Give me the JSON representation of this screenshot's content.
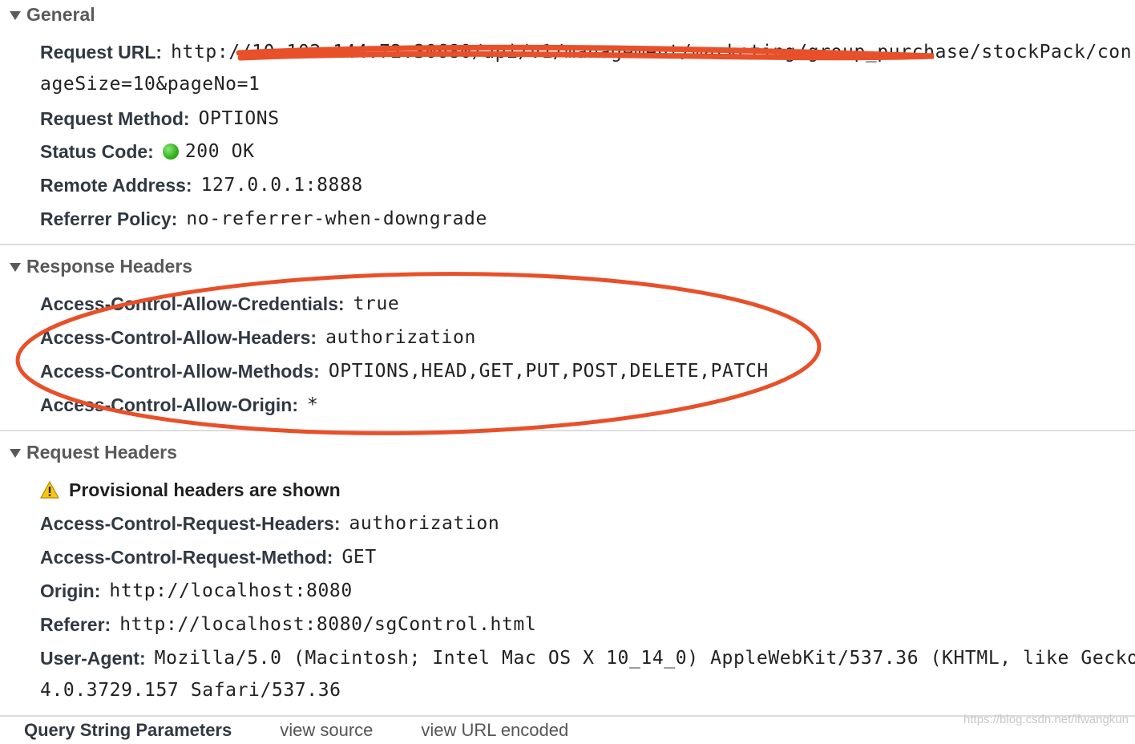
{
  "general": {
    "title": "General",
    "url_key": "Request URL:",
    "url_value": "http://10.102.144.72:30680/api/v1/management/marketing/group_purchase/stockPack/con",
    "url_cont": "ageSize=10&pageNo=1",
    "method_key": "Request Method:",
    "method_value": "OPTIONS",
    "status_key": "Status Code:",
    "status_value": "200 OK",
    "status_color": "#31b01c",
    "remote_key": "Remote Address:",
    "remote_value": "127.0.0.1:8888",
    "policy_key": "Referrer Policy:",
    "policy_value": "no-referrer-when-downgrade"
  },
  "response": {
    "title": "Response Headers",
    "headers": [
      {
        "key": "Access-Control-Allow-Credentials:",
        "value": "true"
      },
      {
        "key": "Access-Control-Allow-Headers:",
        "value": "authorization"
      },
      {
        "key": "Access-Control-Allow-Methods:",
        "value": "OPTIONS,HEAD,GET,PUT,POST,DELETE,PATCH"
      },
      {
        "key": "Access-Control-Allow-Origin:",
        "value": "*"
      }
    ]
  },
  "request": {
    "title": "Request Headers",
    "provisional": "Provisional headers are shown",
    "headers": [
      {
        "key": "Access-Control-Request-Headers:",
        "value": "authorization"
      },
      {
        "key": "Access-Control-Request-Method:",
        "value": "GET"
      },
      {
        "key": "Origin:",
        "value": "http://localhost:8080"
      },
      {
        "key": "Referer:",
        "value": "http://localhost:8080/sgControl.html"
      },
      {
        "key": "User-Agent:",
        "value": "Mozilla/5.0 (Macintosh; Intel Mac OS X 10_14_0) AppleWebKit/537.36 (KHTML, like Gecko"
      }
    ],
    "ua_cont": "4.0.3729.157 Safari/537.36"
  },
  "query": {
    "title": "Query String Parameters",
    "view_source": "view source",
    "view_url": "view URL encoded"
  },
  "watermark": "https://blog.csdn.net/lfwangkun",
  "annotation_color": "#e8502a",
  "icons": {
    "section_toggle": "triangle-down-icon",
    "status": "green-dot-icon",
    "warning": "warning-triangle-icon"
  }
}
